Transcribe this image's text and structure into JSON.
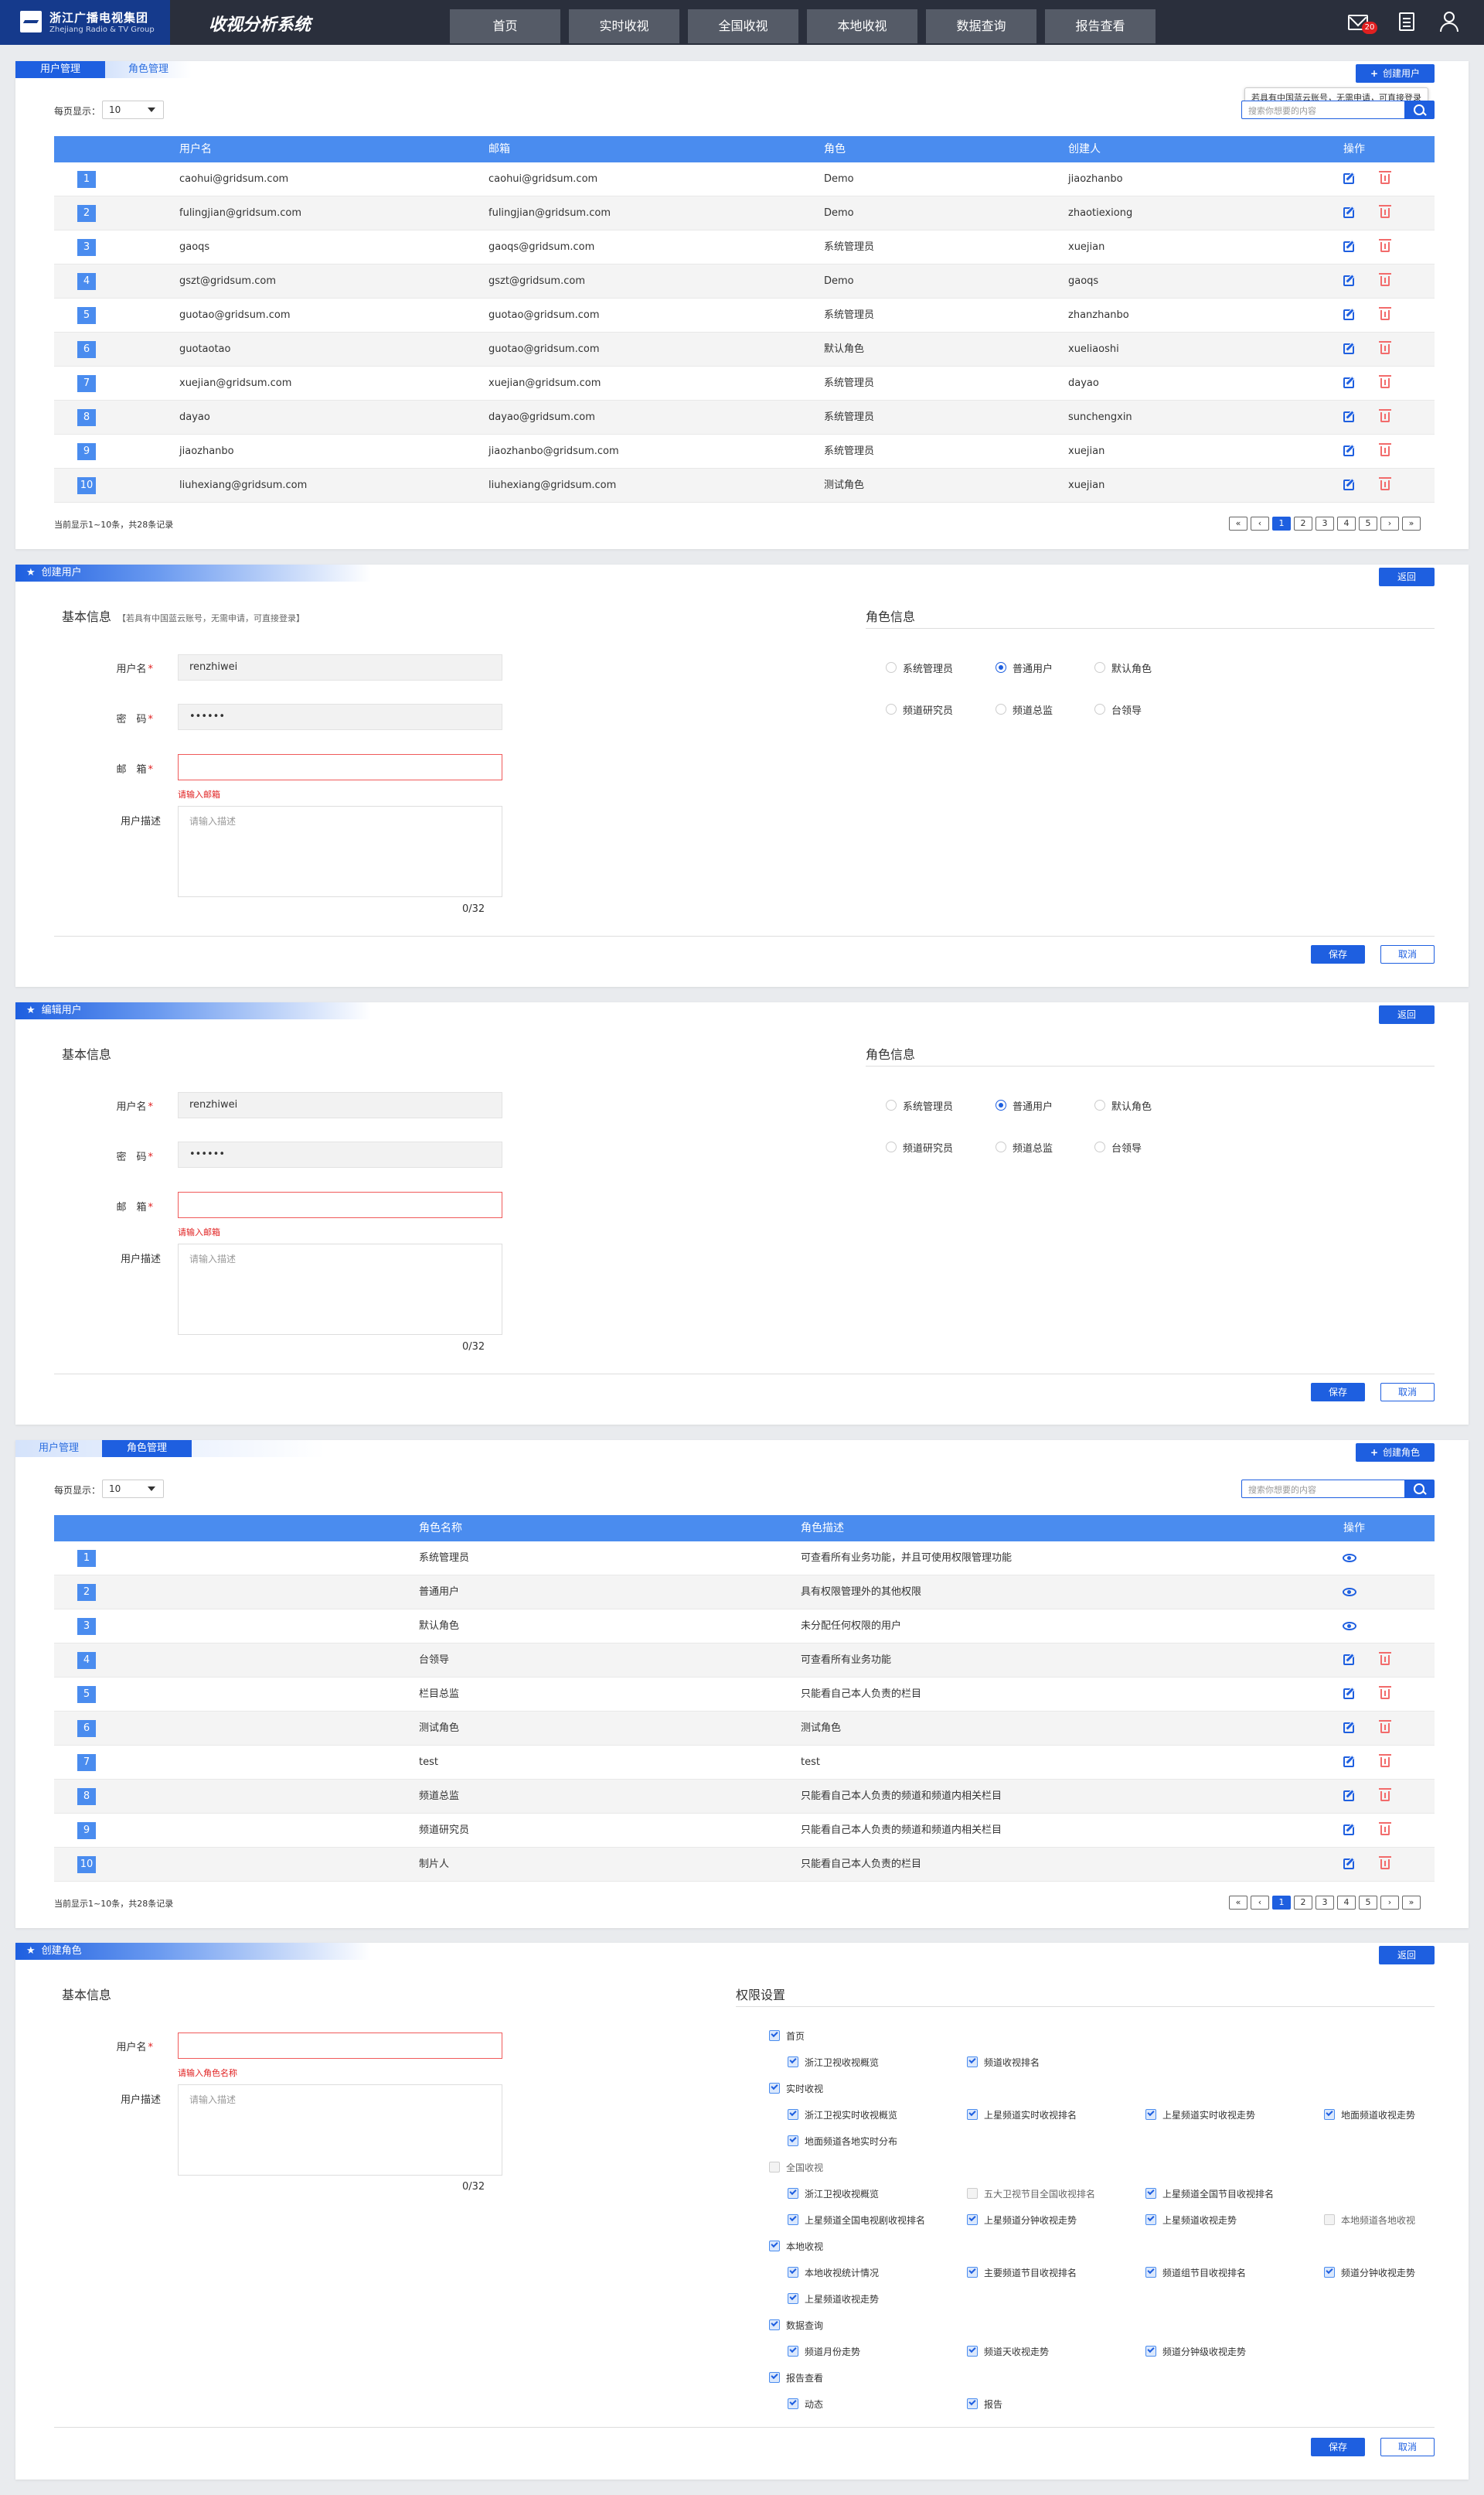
{
  "header": {
    "logo_cn": "浙江广播电视集团",
    "logo_en": "Zhejiang Radio & TV Group",
    "app_title": "收视分析系统",
    "nav": [
      "首页",
      "实时收视",
      "全国收视",
      "本地收视",
      "数据查询",
      "报告查看"
    ],
    "mail_badge": "20"
  },
  "user_list": {
    "tabs": [
      "用户管理",
      "角色管理"
    ],
    "create_button": "创建用户",
    "tooltip": "若具有中国蓝云账号，无需申请，可直接登录",
    "per_page_label": "每页显示：",
    "per_page_value": "10",
    "search_placeholder": "搜索你想要的内容",
    "columns": [
      "用户名",
      "邮箱",
      "角色",
      "创建人",
      "操作"
    ],
    "rows": [
      {
        "no": "1",
        "username": "caohui@gridsum.com",
        "email": "caohui@gridsum.com",
        "role": "Demo",
        "creator": "jiaozhanbo"
      },
      {
        "no": "2",
        "username": "fulingjian@gridsum.com",
        "email": "fulingjian@gridsum.com",
        "role": "Demo",
        "creator": "zhaotiexiong"
      },
      {
        "no": "3",
        "username": "gaoqs",
        "email": "gaoqs@gridsum.com",
        "role": "系统管理员",
        "creator": "xuejian"
      },
      {
        "no": "4",
        "username": "gszt@gridsum.com",
        "email": "gszt@gridsum.com",
        "role": "Demo",
        "creator": "gaoqs"
      },
      {
        "no": "5",
        "username": "guotao@gridsum.com",
        "email": "guotao@gridsum.com",
        "role": "系统管理员",
        "creator": "zhanzhanbo"
      },
      {
        "no": "6",
        "username": "guotaotao",
        "email": "guotao@gridsum.com",
        "role": "默认角色",
        "creator": "xueliaoshi"
      },
      {
        "no": "7",
        "username": "xuejian@gridsum.com",
        "email": "xuejian@gridsum.com",
        "role": "系统管理员",
        "creator": "dayao"
      },
      {
        "no": "8",
        "username": "dayao",
        "email": "dayao@gridsum.com",
        "role": "系统管理员",
        "creator": "sunchengxin"
      },
      {
        "no": "9",
        "username": "jiaozhanbo",
        "email": "jiaozhanbo@gridsum.com",
        "role": "系统管理员",
        "creator": "xuejian"
      },
      {
        "no": "10",
        "username": "liuhexiang@gridsum.com",
        "email": "liuhexiang@gridsum.com",
        "role": "测试角色",
        "creator": "xuejian"
      }
    ],
    "record_info": "当前显示1~10条，共28条记录",
    "pager": [
      "«",
      "‹",
      "1",
      "2",
      "3",
      "4",
      "5",
      "›",
      "»"
    ]
  },
  "create_user": {
    "title": "创建用户",
    "back": "返回",
    "basic_info": "基本信息",
    "basic_note": "【若具有中国蓝云账号，无需申请，可直接登录】",
    "role_info": "角色信息",
    "username_label": "用户名",
    "username_value": "renzhiwei",
    "password_label": "密　码",
    "password_value": "••••••",
    "email_label": "邮　箱",
    "email_error": "请输入邮箱",
    "desc_label": "用户描述",
    "desc_placeholder": "请输入描述",
    "counter": "0/32",
    "roles": [
      "系统管理员",
      "普通用户",
      "默认角色",
      "频道研究员",
      "频道总监",
      "台领导"
    ],
    "selected_role": "普通用户",
    "save": "保存",
    "cancel": "取消"
  },
  "edit_user": {
    "title": "编辑用户",
    "back": "返回",
    "basic_info": "基本信息",
    "role_info": "角色信息",
    "username_label": "用户名",
    "username_value": "renzhiwei",
    "password_label": "密　码",
    "password_value": "••••••",
    "email_label": "邮　箱",
    "email_error": "请输入邮箱",
    "desc_label": "用户描述",
    "desc_placeholder": "请输入描述",
    "counter": "0/32",
    "roles": [
      "系统管理员",
      "普通用户",
      "默认角色",
      "频道研究员",
      "频道总监",
      "台领导"
    ],
    "selected_role": "普通用户",
    "save": "保存",
    "cancel": "取消"
  },
  "role_list": {
    "tabs": [
      "用户管理",
      "角色管理"
    ],
    "create_button": "创建角色",
    "per_page_label": "每页显示：",
    "per_page_value": "10",
    "search_placeholder": "搜索你想要的内容",
    "columns": [
      "角色名称",
      "角色描述",
      "操作"
    ],
    "rows": [
      {
        "no": "1",
        "name": "系统管理员",
        "desc": "可查看所有业务功能，并且可使用权限管理功能",
        "action": "view"
      },
      {
        "no": "2",
        "name": "普通用户",
        "desc": "具有权限管理外的其他权限",
        "action": "view"
      },
      {
        "no": "3",
        "name": "默认角色",
        "desc": "未分配任何权限的用户",
        "action": "view"
      },
      {
        "no": "4",
        "name": "台领导",
        "desc": "可查看所有业务功能",
        "action": "edit"
      },
      {
        "no": "5",
        "name": "栏目总监",
        "desc": "只能看自己本人负责的栏目",
        "action": "edit"
      },
      {
        "no": "6",
        "name": "测试角色",
        "desc": "测试角色",
        "action": "edit"
      },
      {
        "no": "7",
        "name": "test",
        "desc": "test",
        "action": "edit"
      },
      {
        "no": "8",
        "name": "频道总监",
        "desc": "只能看自己本人负责的频道和频道内相关栏目",
        "action": "edit"
      },
      {
        "no": "9",
        "name": "频道研究员",
        "desc": "只能看自己本人负责的频道和频道内相关栏目",
        "action": "edit"
      },
      {
        "no": "10",
        "name": "制片人",
        "desc": "只能看自己本人负责的栏目",
        "action": "edit"
      }
    ],
    "record_info": "当前显示1~10条，共28条记录",
    "pager": [
      "«",
      "‹",
      "1",
      "2",
      "3",
      "4",
      "5",
      "›",
      "»"
    ]
  },
  "create_role": {
    "title": "创建角色",
    "back": "返回",
    "basic_info": "基本信息",
    "perm_title": "权限设置",
    "name_label": "用户名",
    "name_error": "请输入角色名称",
    "desc_label": "用户描述",
    "desc_placeholder": "请输入描述",
    "counter": "0/32",
    "groups": [
      {
        "name": "首页",
        "checked": true,
        "items": [
          {
            "label": "浙江卫视收视概览",
            "checked": true
          },
          {
            "label": "频道收视排名",
            "checked": true
          }
        ]
      },
      {
        "name": "实时收视",
        "checked": true,
        "items": [
          {
            "label": "浙江卫视实时收视概览",
            "checked": true
          },
          {
            "label": "上星频道实时收视排名",
            "checked": true
          },
          {
            "label": "上星频道实时收视走势",
            "checked": true
          },
          {
            "label": "地面频道收视走势",
            "checked": true
          },
          {
            "label": "地面频道各地实时分布",
            "checked": true
          }
        ]
      },
      {
        "name": "全国收视",
        "checked": false,
        "items": [
          {
            "label": "浙江卫视收视概览",
            "checked": true
          },
          {
            "label": "五大卫视节目全国收视排名",
            "checked": false
          },
          {
            "label": "上星频道全国节目收视排名",
            "checked": true
          },
          {
            "label": "上星频道全国电视剧收视排名",
            "checked": true
          },
          {
            "label": "上星频道分钟收视走势",
            "checked": true
          },
          {
            "label": "上星频道收视走势",
            "checked": true
          },
          {
            "label": "本地频道各地收视",
            "checked": false
          }
        ]
      },
      {
        "name": "本地收视",
        "checked": true,
        "items": [
          {
            "label": "本地收视统计情况",
            "checked": true
          },
          {
            "label": "主要频道节目收视排名",
            "checked": true
          },
          {
            "label": "频道组节目收视排名",
            "checked": true
          },
          {
            "label": "频道分钟收视走势",
            "checked": true
          },
          {
            "label": "上星频道收视走势",
            "checked": true
          }
        ]
      },
      {
        "name": "数据查询",
        "checked": true,
        "items": [
          {
            "label": "频道月份走势",
            "checked": true
          },
          {
            "label": "频道天收视走势",
            "checked": true
          },
          {
            "label": "频道分钟级收视走势",
            "checked": true
          }
        ]
      },
      {
        "name": "报告查看",
        "checked": true,
        "items": [
          {
            "label": "动态",
            "checked": true
          },
          {
            "label": "报告",
            "checked": true
          }
        ]
      }
    ],
    "save": "保存",
    "cancel": "取消"
  }
}
